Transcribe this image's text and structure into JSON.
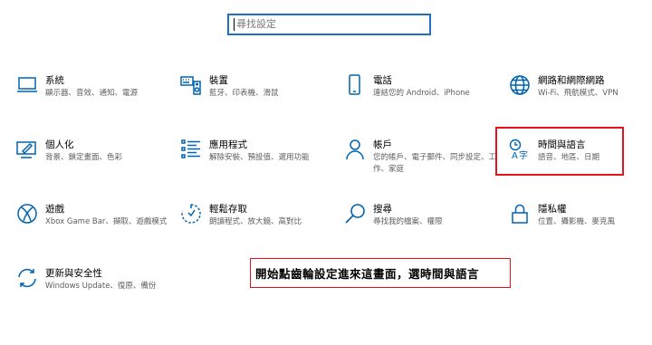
{
  "search": {
    "placeholder": "尋找設定"
  },
  "tiles": [
    {
      "title": "系統",
      "desc": "顯示器、音效、通知、電源",
      "icon": "laptop-icon"
    },
    {
      "title": "裝置",
      "desc": "藍牙、印表機、滑鼠",
      "icon": "keyboard-speaker-icon"
    },
    {
      "title": "電話",
      "desc": "連結您的 Android、iPhone",
      "icon": "phone-icon"
    },
    {
      "title": "網路和網際網路",
      "desc": "Wi-Fi、飛航模式、VPN",
      "icon": "globe-icon"
    },
    {
      "title": "個人化",
      "desc": "背景、鎖定畫面、色彩",
      "icon": "paint-icon"
    },
    {
      "title": "應用程式",
      "desc": "解除安裝、預設值、選用功能",
      "icon": "apps-list-icon"
    },
    {
      "title": "帳戶",
      "desc": "您的帳戶、電子郵件、同步設定、工作、家庭",
      "icon": "person-icon"
    },
    {
      "title": "時間與語言",
      "desc": "語音、地區、日期",
      "icon": "time-language-icon"
    },
    {
      "title": "遊戲",
      "desc": "Xbox Game Bar、擷取、遊戲模式",
      "icon": "xbox-icon"
    },
    {
      "title": "輕鬆存取",
      "desc": "朗讀程式、放大鏡、高對比",
      "icon": "ease-of-access-icon"
    },
    {
      "title": "搜尋",
      "desc": "尋找我的檔案、權限",
      "icon": "search-icon"
    },
    {
      "title": "隱私權",
      "desc": "位置、攝影機、麥克風",
      "icon": "lock-icon"
    },
    {
      "title": "更新與安全性",
      "desc": "Windows Update、復原、備份",
      "icon": "update-sync-icon"
    }
  ],
  "annotation": {
    "text": "開始點齒輪設定進來這畫面，選時間與語言"
  },
  "colors": {
    "accent": "#0063b1",
    "highlight": "#e3141b",
    "search_border": "#1f6fc4"
  }
}
